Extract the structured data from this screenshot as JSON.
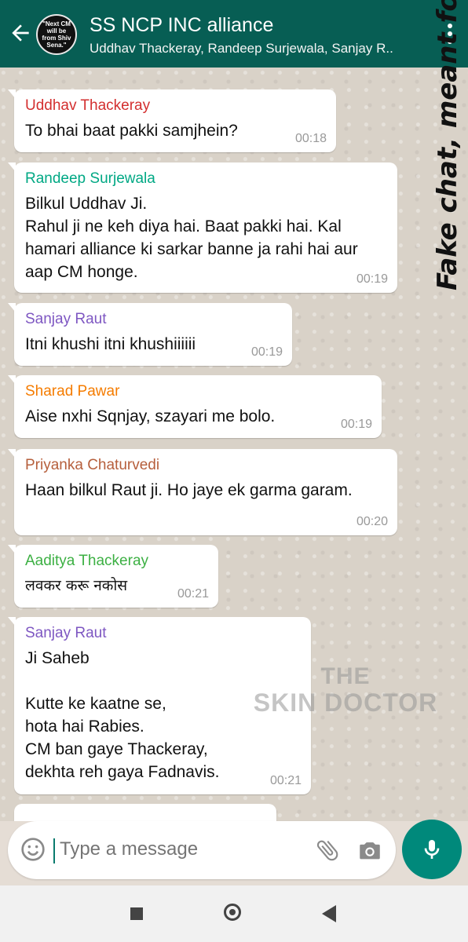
{
  "header": {
    "title": "SS NCP INC alliance",
    "subtitle": "Uddhav Thackeray, Randeep Surjewala, Sanjay R..",
    "avatar_text": "\"Next CM will be from Shiv Sena.\""
  },
  "messages": [
    {
      "sender": "Uddhav Thackeray",
      "color": "#d32f2f",
      "text": "To bhai baat pakki samjhein?",
      "time": "00:18"
    },
    {
      "sender": "Randeep Surjewala",
      "color": "#00a884",
      "text": "Bilkul Uddhav Ji.\nRahul ji ne keh diya hai. Baat pakki hai. Kal hamari alliance ki sarkar banne ja rahi hai aur aap CM honge.",
      "time": "00:19"
    },
    {
      "sender": "Sanjay Raut",
      "color": "#7e57c2",
      "text": "Itni khushi itni khushiiiiii",
      "time": "00:19"
    },
    {
      "sender": "Sharad Pawar",
      "color": "#f57c00",
      "text": "Aise nxhi Sqnjay, szayari me bolo.",
      "time": "00:19"
    },
    {
      "sender": "Priyanka Chaturvedi",
      "color": "#b65f3c",
      "text": "Haan bilkul Raut ji. Ho jaye ek garma garam.",
      "time": "00:20"
    },
    {
      "sender": "Aaditya Thackeray",
      "color": "#3cb043",
      "text": "लवकर करू नकोस",
      "time": "00:21"
    },
    {
      "sender": "Sanjay Raut",
      "color": "#7e57c2",
      "text": "Ji Saheb\n\nKutte ke kaatne se,\nhota hai Rabies.\nCM ban gaye Thackeray,\ndekhta reh gaya Fadnavis.",
      "time": "00:21"
    }
  ],
  "overlay": {
    "satire_text": "Fake chat, meant for satire.",
    "watermark_line1": "THE",
    "watermark_line2": "SKIN DOCTOR"
  },
  "input": {
    "placeholder": "Type a message"
  },
  "icons": {
    "back": "back-arrow-icon",
    "menu": "more-vert-icon",
    "emoji": "emoji-icon",
    "attach": "paperclip-icon",
    "camera": "camera-icon",
    "mic": "mic-icon"
  }
}
